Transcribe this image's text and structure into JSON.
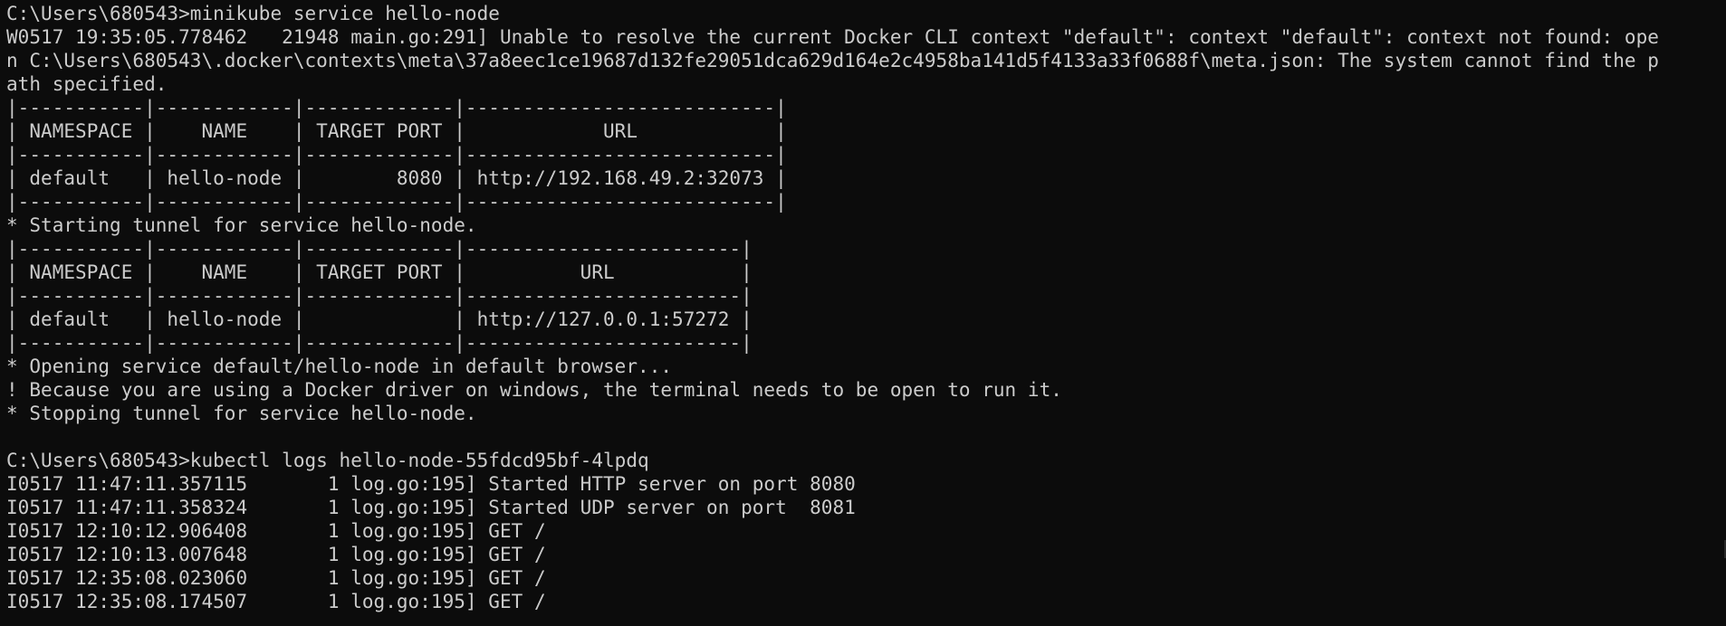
{
  "terminal": {
    "lines": [
      "C:\\Users\\680543>minikube service hello-node",
      "W0517 19:35:05.778462   21948 main.go:291] Unable to resolve the current Docker CLI context \"default\": context \"default\": context not found: ope",
      "n C:\\Users\\680543\\.docker\\contexts\\meta\\37a8eec1ce19687d132fe29051dca629d164e2c4958ba141d5f4133a33f0688f\\meta.json: The system cannot find the p",
      "ath specified.",
      "|-----------|------------|-------------|---------------------------|",
      "| NAMESPACE |    NAME    | TARGET PORT |            URL            |",
      "|-----------|------------|-------------|---------------------------|",
      "| default   | hello-node |        8080 | http://192.168.49.2:32073 |",
      "|-----------|------------|-------------|---------------------------|",
      "* Starting tunnel for service hello-node.",
      "|-----------|------------|-------------|------------------------|",
      "| NAMESPACE |    NAME    | TARGET PORT |          URL           |",
      "|-----------|------------|-------------|------------------------|",
      "| default   | hello-node |             | http://127.0.0.1:57272 |",
      "|-----------|------------|-------------|------------------------|",
      "* Opening service default/hello-node in default browser...",
      "! Because you are using a Docker driver on windows, the terminal needs to be open to run it.",
      "* Stopping tunnel for service hello-node.",
      "",
      "C:\\Users\\680543>kubectl logs hello-node-55fdcd95bf-4lpdq",
      "I0517 11:47:11.357115       1 log.go:195] Started HTTP server on port 8080",
      "I0517 11:47:11.358324       1 log.go:195] Started UDP server on port  8081",
      "I0517 12:10:12.906408       1 log.go:195] GET /",
      "I0517 12:10:13.007648       1 log.go:195] GET /",
      "I0517 12:35:08.023060       1 log.go:195] GET /",
      "I0517 12:35:08.174507       1 log.go:195] GET /"
    ],
    "colors": {
      "background": "#0c0c0c",
      "foreground": "#cccccc"
    }
  }
}
